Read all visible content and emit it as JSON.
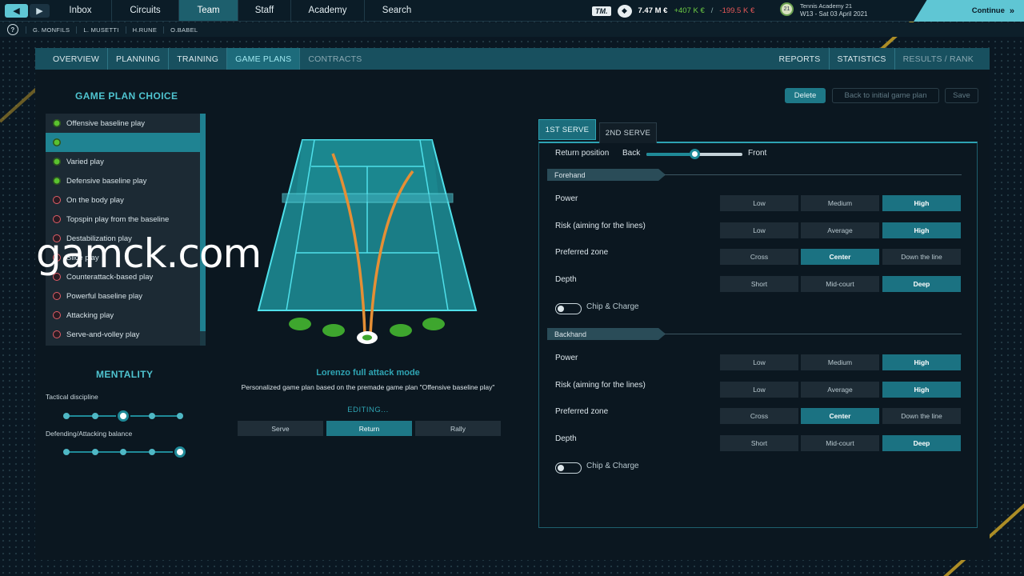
{
  "topbar": {
    "tabs": [
      "Inbox",
      "Circuits",
      "Team",
      "Staff",
      "Academy",
      "Search"
    ],
    "active_tab": "Team",
    "tm_logo": "TM.",
    "balance": "7.47 M €",
    "gain": "+407 K €",
    "separator": "/",
    "loss": "-199.5 K €",
    "club_name": "Tennis Academy 21",
    "date": "W13 - Sat 03 April 2021",
    "continue_label": "Continue",
    "colors": {
      "accent": "#5fc6d4",
      "gain": "#6fcf45",
      "loss": "#e65858"
    }
  },
  "players": [
    "G. MONFILS",
    "L. MUSETTI",
    "H.RUNE",
    "O.BABEL"
  ],
  "subnav": {
    "left": [
      "OVERVIEW",
      "PLANNING",
      "TRAINING",
      "GAME PLANS",
      "CONTRACTS"
    ],
    "right": [
      "REPORTS",
      "STATISTICS",
      "RESULTS / RANK"
    ],
    "active": "GAME PLANS"
  },
  "game_plan_choice": {
    "title": "GAME PLAN CHOICE",
    "items": [
      {
        "label": "Offensive baseline play",
        "status": "green"
      },
      {
        "label": "",
        "status": "green",
        "selected": true
      },
      {
        "label": "Varied play",
        "status": "green"
      },
      {
        "label": "Defensive baseline play",
        "status": "green"
      },
      {
        "label": "On the body play",
        "status": "red"
      },
      {
        "label": "Topspin play from the baseline",
        "status": "red"
      },
      {
        "label": "Destabilization play",
        "status": "red"
      },
      {
        "label": "Slice play",
        "status": "red"
      },
      {
        "label": "Counterattack-based play",
        "status": "red"
      },
      {
        "label": "Powerful baseline play",
        "status": "red"
      },
      {
        "label": "Attacking play",
        "status": "red"
      },
      {
        "label": "Serve-and-volley play",
        "status": "red"
      }
    ]
  },
  "mentality": {
    "title": "MENTALITY",
    "tactical_discipline_label": "Tactical discipline",
    "tactical_discipline_level": 3,
    "balance_label": "Defending/Attacking balance",
    "balance_level": 5,
    "levels": 5
  },
  "plan": {
    "name": "Lorenzo full attack mode",
    "description": "Personalized game plan based on the premade game plan \"Offensive baseline play\"",
    "editing": "EDITING...",
    "modes": [
      "Serve",
      "Return",
      "Rally"
    ],
    "active_mode": "Return"
  },
  "actions": {
    "delete": "Delete",
    "back": "Back to initial game plan",
    "save": "Save"
  },
  "serve_tabs": [
    "1ST SERVE",
    "2ND SERVE"
  ],
  "return_position": {
    "label": "Return position",
    "min_label": "Back",
    "max_label": "Front",
    "value": 0.5
  },
  "forehand": {
    "title": "Forehand",
    "rows": [
      {
        "label": "Power",
        "options": [
          "Low",
          "Medium",
          "High"
        ],
        "selected": 2
      },
      {
        "label": "Risk (aiming for the lines)",
        "options": [
          "Low",
          "Average",
          "High"
        ],
        "selected": 2
      },
      {
        "label": "Preferred zone",
        "options": [
          "Cross",
          "Center",
          "Down the line"
        ],
        "selected": 1
      },
      {
        "label": "Depth",
        "options": [
          "Short",
          "Mid-court",
          "Deep"
        ],
        "selected": 2
      }
    ],
    "toggle_label": "Chip & Charge",
    "toggle_on": false
  },
  "backhand": {
    "title": "Backhand",
    "rows": [
      {
        "label": "Power",
        "options": [
          "Low",
          "Medium",
          "High"
        ],
        "selected": 2
      },
      {
        "label": "Risk (aiming for the lines)",
        "options": [
          "Low",
          "Average",
          "High"
        ],
        "selected": 2
      },
      {
        "label": "Preferred zone",
        "options": [
          "Cross",
          "Center",
          "Down the line"
        ],
        "selected": 1
      },
      {
        "label": "Depth",
        "options": [
          "Short",
          "Mid-court",
          "Deep"
        ],
        "selected": 2
      }
    ],
    "toggle_label": "Chip & Charge",
    "toggle_on": false
  },
  "watermark": "gamck.com"
}
